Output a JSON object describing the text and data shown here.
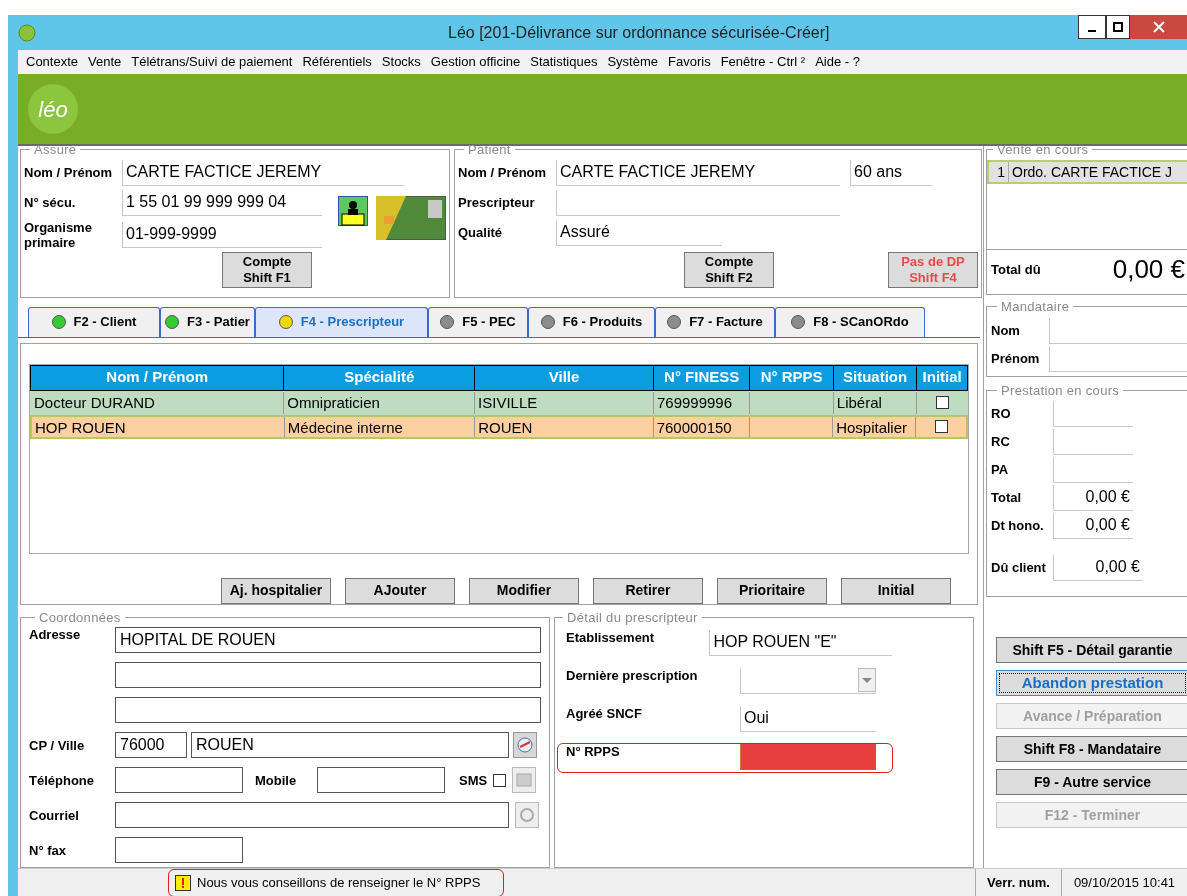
{
  "window": {
    "title": "Léo [201-Délivrance sur ordonnance sécurisée-Créer]"
  },
  "menu": [
    "Contexte",
    "Vente",
    "Télétrans/Suivi de paiement",
    "Référentiels",
    "Stocks",
    "Gestion officine",
    "Statistiques",
    "Système",
    "Favoris",
    "Fenêtre - Ctrl ²",
    "Aide - ?"
  ],
  "banner": {
    "logo": "léo"
  },
  "assure": {
    "legend": "Assuré",
    "fields": [
      {
        "label": "Nom / Prénom",
        "value": "CARTE FACTICE JEREMY"
      },
      {
        "label": "N° sécu.",
        "value": "1 55 01 99 999 999 04"
      },
      {
        "label": "Organisme primaire",
        "value": "01-999-9999"
      }
    ],
    "button": [
      "Compte",
      "Shift F1"
    ]
  },
  "patient": {
    "legend": "Patient",
    "fields": [
      {
        "label": "Nom / Prénom",
        "value": "CARTE FACTICE JEREMY"
      },
      {
        "label": "Prescripteur"
      },
      {
        "label": "Qualité",
        "value": "Assuré"
      }
    ],
    "age": "60 ans",
    "buttons": [
      {
        "lines": [
          "Compte",
          "Shift F2"
        ],
        "kind": "normal"
      },
      {
        "lines": [
          "Pas de DP",
          "Shift F4"
        ],
        "kind": "warning"
      }
    ]
  },
  "vente": {
    "legend": "Vente en cours",
    "items": [
      {
        "num": "1",
        "label": "Ordo. CARTE FACTICE J",
        "selected": true
      }
    ],
    "total_label": "Total dû",
    "total": "0,00 €"
  },
  "tabs": [
    {
      "label": "F2 - Client",
      "color": "#33cc33",
      "selected": false
    },
    {
      "label": "F3 - Patier",
      "color": "#33cc33",
      "selected": false
    },
    {
      "label": "F4 - Prescripteur",
      "color": "#f2d600",
      "selected": true
    },
    {
      "label": "F5 - PEC",
      "color": "#8c8c8c",
      "selected": false
    },
    {
      "label": "F6 - Produits",
      "color": "#8c8c8c",
      "selected": false
    },
    {
      "label": "F7 - Facture",
      "color": "#8c8c8c",
      "selected": false
    },
    {
      "label": "F8  - SCanORdo",
      "color": "#8c8c8c",
      "selected": false
    }
  ],
  "table": {
    "columns": [
      "Nom / Prénom",
      "Spécialité",
      "Ville",
      "N° FINESS",
      "N° RPPS",
      "Situation",
      "Initial"
    ],
    "rows": [
      {
        "cells": [
          "Docteur DURAND",
          "Omnipraticien",
          "ISIVILLE",
          "769999996",
          "",
          "Libéral"
        ],
        "initial": false,
        "color": "#c0dcc0",
        "selected": false
      },
      {
        "cells": [
          "HOP ROUEN",
          "Médecine interne",
          "ROUEN",
          "760000150",
          "",
          "Hospitalier"
        ],
        "initial": false,
        "color": "#fdd0a2",
        "selected": true
      }
    ]
  },
  "table_buttons": [
    "Aj. hospitalier",
    "AJouter",
    "Modifier",
    "Retirer",
    "Prioritaire",
    "Initial"
  ],
  "coordonnees": {
    "legend": "Coordonnées",
    "adresse": {
      "label": "Adresse",
      "line_1": "HOPITAL DE ROUEN"
    },
    "cp_ville": {
      "label": "CP / Ville",
      "cp": "76000",
      "ville": "ROUEN"
    },
    "telephone": {
      "label": "Téléphone"
    },
    "mobile": {
      "label": "Mobile"
    },
    "sms": {
      "label": "SMS",
      "checked": false
    },
    "courriel": {
      "label": "Courriel"
    },
    "fax": {
      "label": "N° fax"
    }
  },
  "detail": {
    "legend": "Détail du prescripteur",
    "rows": [
      {
        "label": "Etablissement",
        "value": "HOP ROUEN   \"E\"",
        "kind": "text",
        "highlighted": false
      },
      {
        "label": "Dernière prescription",
        "kind": "select",
        "highlighted": false
      },
      {
        "label": "Agréé SNCF",
        "value": "Oui",
        "kind": "text",
        "highlighted": false
      },
      {
        "label": "N° RPPS",
        "kind": "error",
        "highlighted": true
      }
    ]
  },
  "mandataire": {
    "legend": "Mandataire",
    "fields": [
      "Nom",
      "Prénom"
    ]
  },
  "prestation": {
    "legend": "Prestation en cours",
    "fields": [
      {
        "label": "RO"
      },
      {
        "label": "RC"
      },
      {
        "label": "PA"
      },
      {
        "label": "Total",
        "value": "0,00 €"
      },
      {
        "label": "Dt hono.",
        "value": "0,00 €"
      },
      {
        "label": "Dû client",
        "value": "0,00 €"
      }
    ]
  },
  "actions": [
    {
      "label": "Shift F5 - Détail garantie",
      "disabled": false,
      "focused": false
    },
    {
      "label": "Abandon prestation",
      "disabled": false,
      "focused": true
    },
    {
      "label": "Avance / Préparation",
      "disabled": true,
      "focused": false
    },
    {
      "label": "Shift F8 - Mandataire",
      "disabled": false,
      "focused": false
    },
    {
      "label": "F9 - Autre service",
      "disabled": false,
      "focused": false
    },
    {
      "label": "F12 - Terminer",
      "disabled": true,
      "focused": false
    }
  ],
  "status_bar": {
    "message": "Nous vous conseillons de renseigner le N° RPPS",
    "keyboard": "Verr. num.",
    "datetime": "09/10/2015 10:41"
  }
}
